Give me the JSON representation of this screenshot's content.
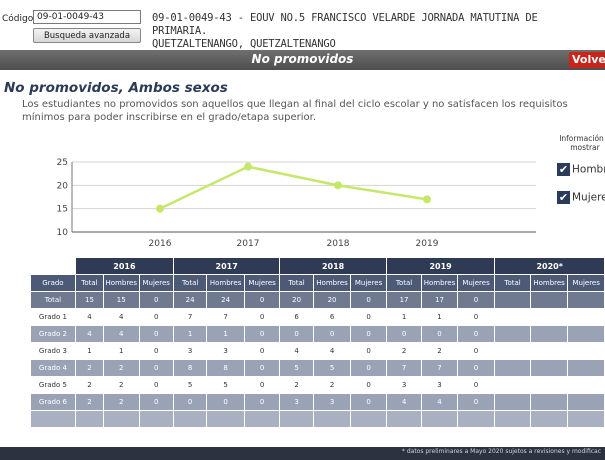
{
  "header": {
    "code_label": "Código",
    "code_value": "09-01-0049-43",
    "advanced_search_label": "Busqueda avanzada",
    "school_line1": "09-01-0049-43 - EOUV NO.5 FRANCISCO VELARDE JORNADA MATUTINA DE PRIMARIA.",
    "school_line2": "QUETZALTENANGO, QUETZALTENANGO"
  },
  "titlebar": {
    "title": "No promovidos",
    "back_label": "Volve"
  },
  "section": {
    "heading": "No promovidos, Ambos sexos",
    "description": "Los estudiantes no promovidos son aquellos que llegan al final del ciclo escolar y no satisfacen los requisitos mínimos para poder inscribirse en el grado/etapa superior."
  },
  "sidebar": {
    "title": "Información a mostrar",
    "options": [
      {
        "label": "Hombres",
        "checked": true
      },
      {
        "label": "Mujeres",
        "checked": true
      }
    ]
  },
  "chart_data": {
    "type": "line",
    "x": [
      "2016",
      "2017",
      "2018",
      "2019"
    ],
    "series": [
      {
        "values": [
          15,
          24,
          20,
          17
        ],
        "color": "#c6e86a"
      }
    ],
    "ylim": [
      10,
      25
    ],
    "yticks": [
      10,
      15,
      20,
      25
    ],
    "grid": true
  },
  "table": {
    "years": [
      "2016",
      "2017",
      "2018",
      "2019",
      "2020*"
    ],
    "columns": [
      "Grado",
      "Total",
      "Hombres",
      "Mujeres",
      "Total",
      "Hombres",
      "Mujeres",
      "Total",
      "Hombres",
      "Mujeres",
      "Total",
      "Hombres",
      "Mujeres",
      "Total",
      "Hombres",
      "Mujeres"
    ],
    "rows": [
      [
        "Total",
        "15",
        "15",
        "0",
        "24",
        "24",
        "0",
        "20",
        "20",
        "0",
        "17",
        "17",
        "0",
        "",
        "",
        ""
      ],
      [
        "Grado 1",
        "4",
        "4",
        "0",
        "7",
        "7",
        "0",
        "6",
        "6",
        "0",
        "1",
        "1",
        "0",
        "",
        "",
        ""
      ],
      [
        "Grado 2",
        "4",
        "4",
        "0",
        "1",
        "1",
        "0",
        "0",
        "0",
        "0",
        "0",
        "0",
        "0",
        "",
        "",
        ""
      ],
      [
        "Grado 3",
        "1",
        "1",
        "0",
        "3",
        "3",
        "0",
        "4",
        "4",
        "0",
        "2",
        "2",
        "0",
        "",
        "",
        ""
      ],
      [
        "Grado 4",
        "2",
        "2",
        "0",
        "8",
        "8",
        "0",
        "5",
        "5",
        "0",
        "7",
        "7",
        "0",
        "",
        "",
        ""
      ],
      [
        "Grado 5",
        "2",
        "2",
        "0",
        "5",
        "5",
        "0",
        "2",
        "2",
        "0",
        "3",
        "3",
        "0",
        "",
        "",
        ""
      ],
      [
        "Grado 6",
        "2",
        "2",
        "0",
        "0",
        "0",
        "0",
        "3",
        "3",
        "0",
        "4",
        "4",
        "0",
        "",
        "",
        ""
      ]
    ]
  },
  "footer": {
    "note": "* datos preliminares a Mayo 2020 sujetos a revisiones y modificac"
  }
}
